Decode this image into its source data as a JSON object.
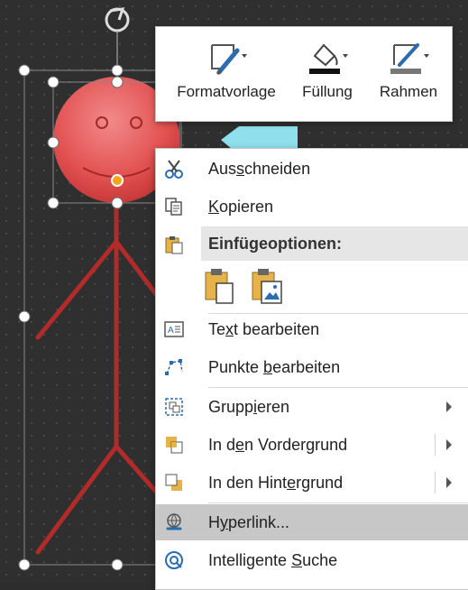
{
  "mini_toolbar": {
    "items": [
      {
        "label": "Formatvorlage",
        "icon": "style-brush-icon"
      },
      {
        "label": "Füllung",
        "icon": "fill-bucket-icon"
      },
      {
        "label": "Rahmen",
        "icon": "outline-pen-icon"
      }
    ]
  },
  "context_menu": {
    "cut": {
      "pre": "Aus",
      "acc": "s",
      "post": "chneiden"
    },
    "copy": {
      "pre": "",
      "acc": "K",
      "post": "opieren"
    },
    "paste_header": "Einfügeoptionen:",
    "edit_text": {
      "pre": "Te",
      "acc": "x",
      "post": "t bearbeiten"
    },
    "edit_points": {
      "pre": "Punkte ",
      "acc": "b",
      "post": "earbeiten"
    },
    "group": {
      "pre": "Grupp",
      "acc": "i",
      "post": "eren"
    },
    "bring_front": {
      "pre": "In d",
      "acc": "e",
      "post": "n Vordergrund"
    },
    "send_back": {
      "pre": "In den Hint",
      "acc": "e",
      "post": "rgrund"
    },
    "hyperlink": {
      "pre": "H",
      "acc": "y",
      "post": "perlink..."
    },
    "smart_lookup": {
      "pre": "Intelligente ",
      "acc": "S",
      "post": "uche"
    }
  },
  "colors": {
    "accent": "#2b6cb0",
    "figure": "#b22b2b",
    "face": "#e05050",
    "shape_cyan": "#8fe0ec"
  }
}
